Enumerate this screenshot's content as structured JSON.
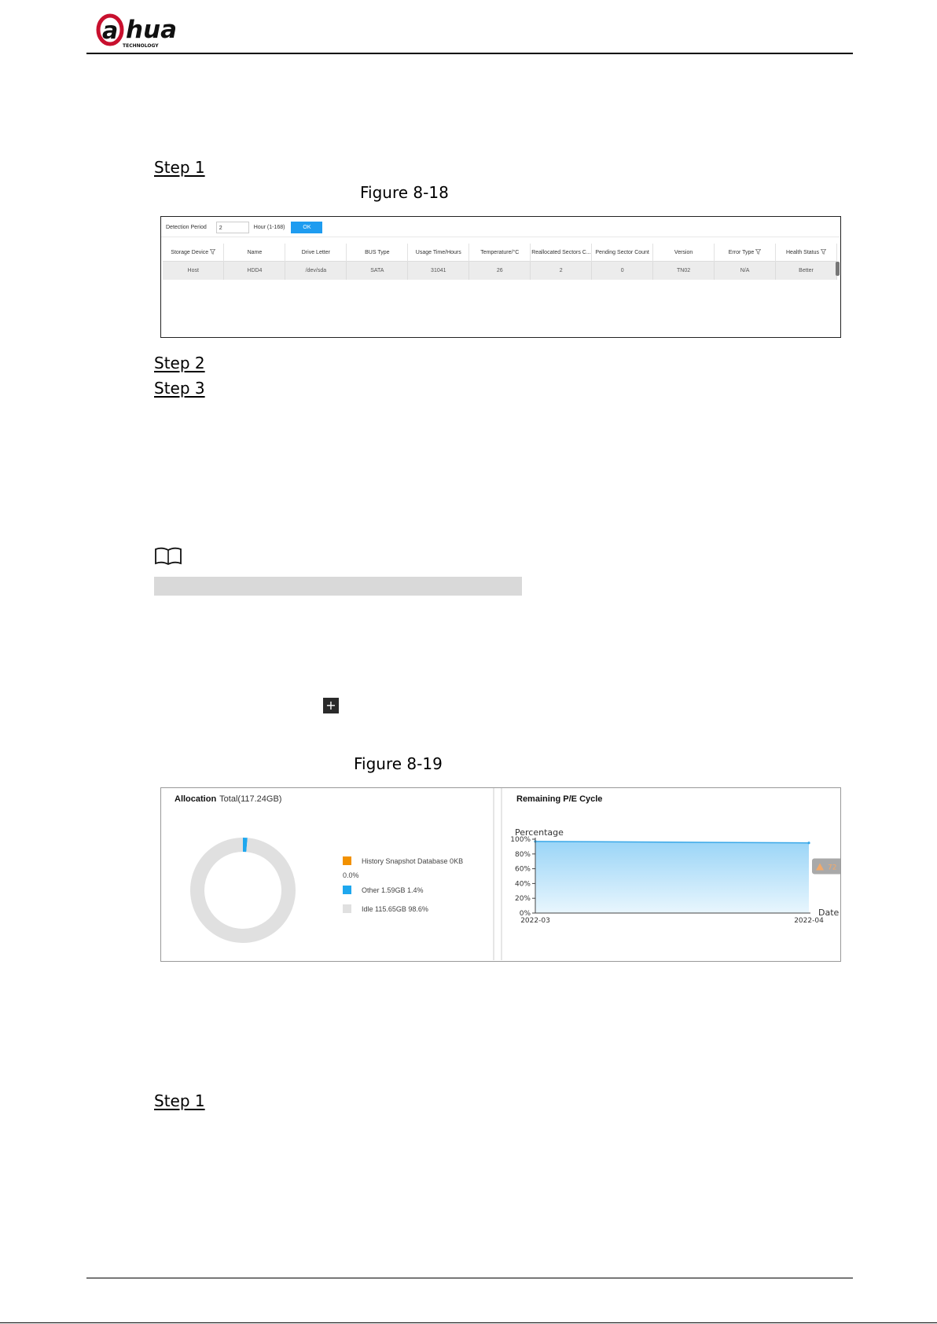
{
  "header": {
    "logo_text": "alhua",
    "logo_sub": "TECHNOLOGY"
  },
  "steps": {
    "s1": "Step 1",
    "s2": "Step 2",
    "s3": "Step 3",
    "s1b": "Step 1"
  },
  "fig18": {
    "caption": "Figure 8-18",
    "detection_label": "Detection Period",
    "detection_value": "2",
    "unit": "Hour  (1-168)",
    "ok": "OK",
    "columns": [
      "Storage Device",
      "Name",
      "Drive Letter",
      "BUS Type",
      "Usage Time/Hours",
      "Temperature/°C",
      "Reallocated Sectors C...",
      "Pending Sector Count",
      "Version",
      "Error Type",
      "Health Status"
    ],
    "row": [
      "Host",
      "HDD4",
      "/dev/sda",
      "SATA",
      "31041",
      "26",
      "2",
      "0",
      "TN02",
      "N/A",
      "Better"
    ]
  },
  "fig19": {
    "caption": "Figure 8-19",
    "alloc_title": "Allocation",
    "alloc_total": "Total(117.24GB)",
    "legend": [
      {
        "label": "History Snapshot Database  0KB",
        "sub": "0.0%",
        "color": "#f29100"
      },
      {
        "label": "Other  1.59GB  1.4%",
        "color": "#1ea7ee"
      },
      {
        "label": "Idle  115.65GB  98.6%",
        "color": "#e0e0e0"
      }
    ],
    "pe_title": "Remaining P/E Cycle"
  },
  "chart_data": {
    "type": "area",
    "title": "Remaining P/E Cycle",
    "ylabel": "Percentage",
    "xlabel": "Date",
    "x": [
      "2022-03",
      "2022-04"
    ],
    "series": [
      {
        "values": [
          97,
          95
        ]
      }
    ],
    "yticks": [
      "0%",
      "20%",
      "40%",
      "60%",
      "80%",
      "100%"
    ],
    "ylim": [
      0,
      100
    ],
    "badge": "72",
    "color": "#3aa8e8"
  },
  "donut": {
    "type": "pie",
    "values": [
      0.0,
      1.4,
      98.6
    ],
    "colors": [
      "#f29100",
      "#1ea7ee",
      "#e0e0e0"
    ]
  }
}
